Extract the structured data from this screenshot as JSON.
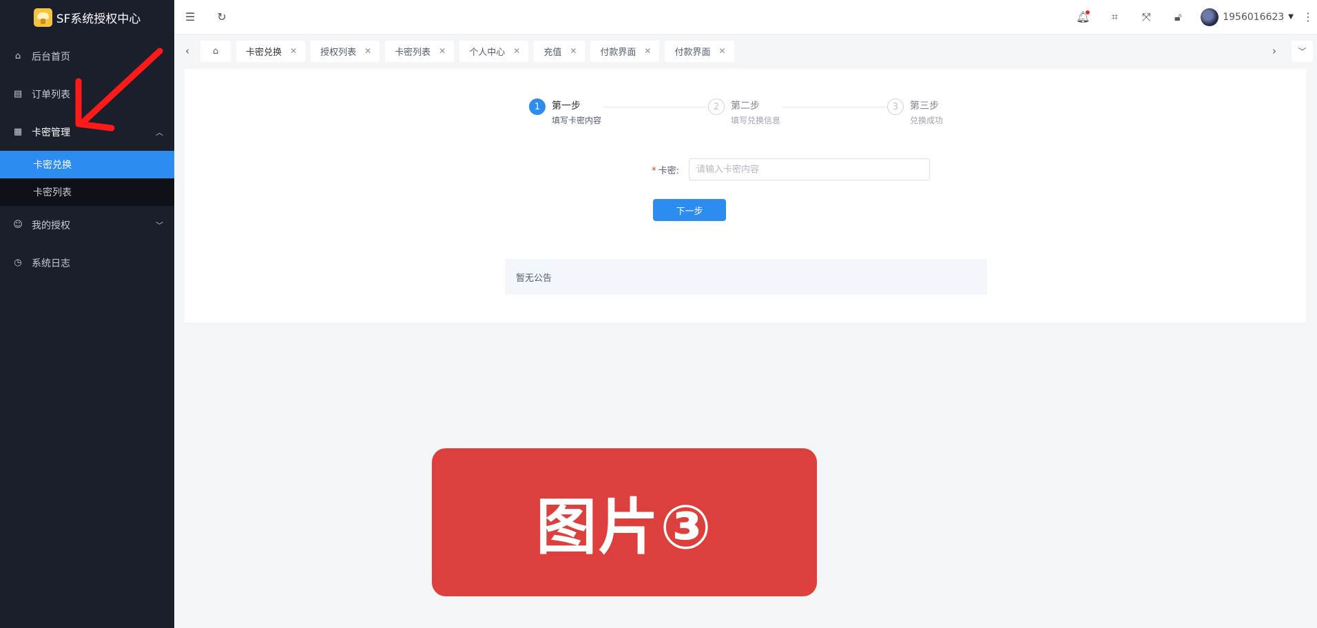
{
  "app": {
    "title": "SF系统授权中心"
  },
  "sidebar": {
    "items": [
      {
        "label": "后台首页",
        "icon": "home-icon"
      },
      {
        "label": "订单列表",
        "icon": "document-icon"
      },
      {
        "label": "卡密管理",
        "icon": "grid-icon",
        "expanded": true,
        "children": [
          {
            "label": "卡密兑换",
            "active": true
          },
          {
            "label": "卡密列表"
          }
        ]
      },
      {
        "label": "我的授权",
        "icon": "smile-icon",
        "expanded": false
      },
      {
        "label": "系统日志",
        "icon": "clock-icon"
      }
    ]
  },
  "header": {
    "username": "1956016623",
    "icons": [
      "menu-fold-icon",
      "refresh-icon",
      "bell-icon",
      "tag-icon",
      "fullscreen-icon",
      "lock-icon",
      "more-icon"
    ]
  },
  "tabs": [
    "卡密兑换",
    "授权列表",
    "卡密列表",
    "个人中心",
    "充值",
    "付款界面",
    "付款界面"
  ],
  "steps": [
    {
      "number": "1",
      "title": "第一步",
      "desc": "填写卡密内容",
      "active": true
    },
    {
      "number": "2",
      "title": "第二步",
      "desc": "填写兑换信息",
      "active": false
    },
    {
      "number": "3",
      "title": "第三步",
      "desc": "兑换成功",
      "active": false
    }
  ],
  "form": {
    "label": "卡密:",
    "required_mark": "*",
    "placeholder": "请输入卡密内容",
    "value": "",
    "submit_label": "下一步"
  },
  "notice": {
    "text": "暂无公告"
  },
  "overlay_label": "图片③",
  "colors": {
    "sidebar_bg": "#1b1e2b",
    "primary": "#2d8cf0",
    "overlay_red": "#dd3f3c",
    "annotation_arrow": "#ff1a1a"
  }
}
